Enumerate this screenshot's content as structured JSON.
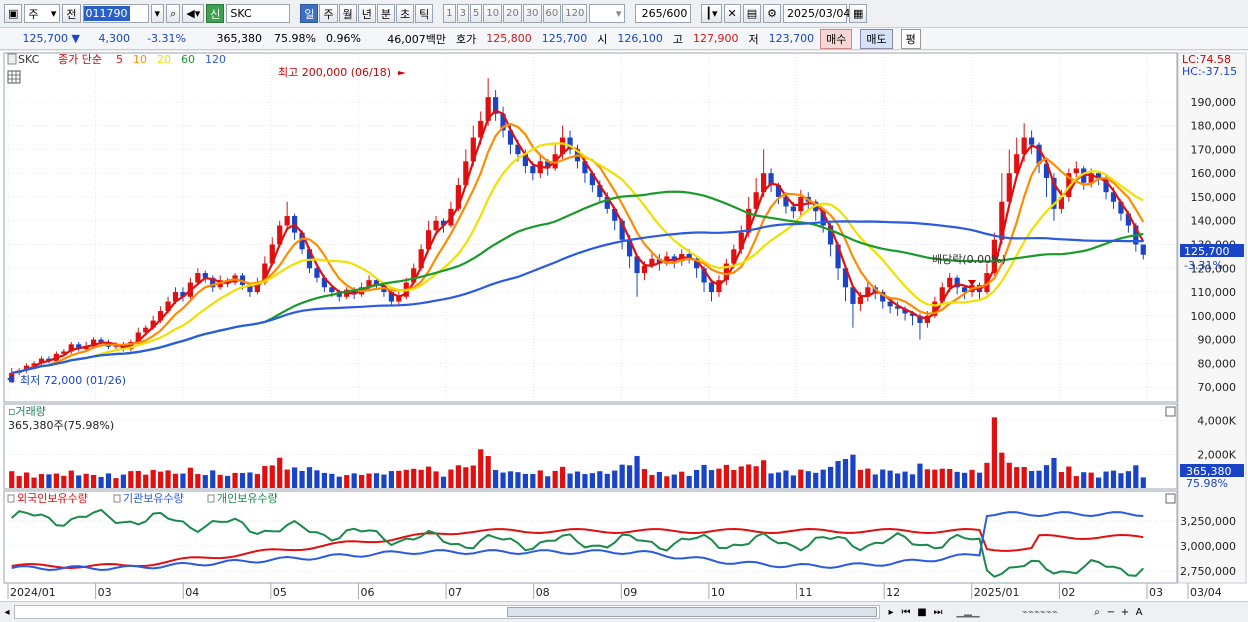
{
  "toolbar": {
    "type_select": "주",
    "prev_label": "전",
    "code": "011790",
    "badge": "신",
    "stock_name": "SKC",
    "periods": [
      "일",
      "주",
      "월",
      "년",
      "분",
      "초",
      "틱"
    ],
    "active_period": "일",
    "intervals": [
      "1",
      "3",
      "5",
      "10",
      "20",
      "30",
      "60",
      "120"
    ],
    "count": "265",
    "count_max": "/600",
    "date": "2025/03/04"
  },
  "infobar": {
    "price": "125,700",
    "change": "4,300",
    "change_pct": "-3.31%",
    "volume": "365,380",
    "vol_ratio": "75.98%",
    "turnover": "0.96%",
    "amount": "46,007백만",
    "quote_label": "호가",
    "ask": "125,800",
    "bid": "125,700",
    "open_label": "시",
    "open": "126,100",
    "high_label": "고",
    "high": "127,900",
    "low_label": "저",
    "low": "123,700",
    "buy_label": "매수",
    "sell_label": "매도",
    "avg_label": "평"
  },
  "price_panel": {
    "symbol": "SKC",
    "ma_title": "종가 단순",
    "ma_periods": [
      "5",
      "10",
      "20",
      "60",
      "120"
    ],
    "ma_colors": [
      "#e01010",
      "#ff8c00",
      "#f0e000",
      "#1a9a2a",
      "#2a5ae0"
    ],
    "lc": "LC:74.58",
    "hc": "HC:-37.15",
    "y_ticks": [
      "190,000",
      "180,000",
      "170,000",
      "160,000",
      "150,000",
      "140,000",
      "130,000",
      "120,000",
      "110,000",
      "100,000",
      "90,000",
      "80,000",
      "70,000"
    ],
    "high_annotation": "최고 200,000 (06/18)",
    "low_annotation": "최저 72,000 (01/26)",
    "dividend_annotation": "배당락(0.00%)",
    "last_price_tag": "125,700",
    "last_pct_tag": "-3.31%"
  },
  "volume_panel": {
    "title": "거래량",
    "value": "365,380주(75.98%)",
    "y_ticks": [
      "4,000K",
      "2,000K"
    ],
    "last_tag": "365,380",
    "last_pct_tag": "75.98%"
  },
  "holding_panel": {
    "series": [
      "외국인보유수량",
      "기관보유수량",
      "개인보유수량"
    ],
    "series_colors": [
      "#e01010",
      "#2a5ae0",
      "#1a8a4a"
    ],
    "y_ticks": [
      "3,250,000",
      "3,000,000",
      "2,750,000"
    ]
  },
  "x_axis": {
    "labels": [
      "2024/01",
      "03",
      "04",
      "05",
      "06",
      "07",
      "08",
      "09",
      "10",
      "11",
      "12",
      "2025/01",
      "02",
      "03",
      "03/04"
    ]
  },
  "chart_data": {
    "type": "line",
    "candles": [
      [
        76000,
        72000,
        78000,
        72000
      ],
      [
        77000,
        76000,
        78000,
        75000
      ],
      [
        79000,
        77000,
        80000,
        76000
      ],
      [
        80000,
        79000,
        81000,
        78000
      ],
      [
        82000,
        80000,
        83000,
        79000
      ],
      [
        81000,
        82000,
        83000,
        80000
      ],
      [
        84000,
        81000,
        85000,
        80000
      ],
      [
        85000,
        84000,
        86000,
        83000
      ],
      [
        88000,
        85000,
        89000,
        84000
      ],
      [
        86000,
        88000,
        89000,
        85000
      ],
      [
        87000,
        86000,
        89000,
        85000
      ],
      [
        90000,
        87000,
        91000,
        86000
      ],
      [
        89000,
        90000,
        91000,
        88000
      ],
      [
        87000,
        89000,
        90000,
        86000
      ],
      [
        88000,
        87000,
        89000,
        86000
      ],
      [
        86000,
        88000,
        89000,
        85000
      ],
      [
        89000,
        86000,
        90000,
        85000
      ],
      [
        93000,
        89000,
        95000,
        88000
      ],
      [
        95000,
        93000,
        96000,
        92000
      ],
      [
        98000,
        95000,
        100000,
        94000
      ],
      [
        102000,
        98000,
        104000,
        97000
      ],
      [
        106000,
        102000,
        108000,
        101000
      ],
      [
        110000,
        106000,
        112000,
        105000
      ],
      [
        108000,
        110000,
        112000,
        106000
      ],
      [
        114000,
        108000,
        116000,
        107000
      ],
      [
        118000,
        114000,
        120000,
        113000
      ],
      [
        116000,
        118000,
        119000,
        114000
      ],
      [
        112000,
        116000,
        117000,
        110000
      ],
      [
        115000,
        112000,
        117000,
        111000
      ],
      [
        114000,
        115000,
        116000,
        112000
      ],
      [
        117000,
        114000,
        118000,
        113000
      ],
      [
        113000,
        117000,
        118000,
        111000
      ],
      [
        110000,
        113000,
        114000,
        108000
      ],
      [
        114000,
        110000,
        116000,
        109000
      ],
      [
        122000,
        114000,
        125000,
        113000
      ],
      [
        130000,
        122000,
        133000,
        121000
      ],
      [
        138000,
        130000,
        140000,
        129000
      ],
      [
        142000,
        138000,
        148000,
        137000
      ],
      [
        135000,
        142000,
        143000,
        132000
      ],
      [
        128000,
        135000,
        136000,
        126000
      ],
      [
        120000,
        128000,
        129000,
        118000
      ],
      [
        116000,
        120000,
        121000,
        114000
      ],
      [
        112000,
        116000,
        117000,
        110000
      ],
      [
        110000,
        112000,
        113000,
        108000
      ],
      [
        108000,
        110000,
        111000,
        106000
      ],
      [
        111000,
        108000,
        112000,
        107000
      ],
      [
        109000,
        111000,
        112000,
        107000
      ],
      [
        112000,
        109000,
        114000,
        108000
      ],
      [
        115000,
        112000,
        117000,
        111000
      ],
      [
        113000,
        115000,
        116000,
        111000
      ],
      [
        110000,
        113000,
        114000,
        108000
      ],
      [
        106000,
        110000,
        111000,
        104000
      ],
      [
        108000,
        106000,
        110000,
        104000
      ],
      [
        114000,
        108000,
        116000,
        107000
      ],
      [
        120000,
        114000,
        122000,
        113000
      ],
      [
        128000,
        120000,
        130000,
        119000
      ],
      [
        136000,
        128000,
        140000,
        127000
      ],
      [
        140000,
        136000,
        142000,
        134000
      ],
      [
        138000,
        140000,
        141000,
        135000
      ],
      [
        145000,
        138000,
        148000,
        137000
      ],
      [
        155000,
        145000,
        158000,
        144000
      ],
      [
        165000,
        155000,
        170000,
        154000
      ],
      [
        175000,
        165000,
        180000,
        163000
      ],
      [
        182000,
        175000,
        186000,
        172000
      ],
      [
        192000,
        182000,
        200000,
        180000
      ],
      [
        185000,
        192000,
        195000,
        182000
      ],
      [
        178000,
        185000,
        188000,
        175000
      ],
      [
        172000,
        178000,
        180000,
        168000
      ],
      [
        168000,
        172000,
        174000,
        165000
      ],
      [
        163000,
        168000,
        170000,
        160000
      ],
      [
        160000,
        163000,
        165000,
        157000
      ],
      [
        165000,
        160000,
        168000,
        158000
      ],
      [
        162000,
        165000,
        166000,
        159000
      ],
      [
        168000,
        162000,
        172000,
        161000
      ],
      [
        175000,
        168000,
        180000,
        166000
      ],
      [
        170000,
        175000,
        178000,
        168000
      ],
      [
        165000,
        170000,
        172000,
        162000
      ],
      [
        160000,
        165000,
        166000,
        156000
      ],
      [
        155000,
        160000,
        161000,
        152000
      ],
      [
        150000,
        155000,
        157000,
        148000
      ],
      [
        145000,
        150000,
        152000,
        143000
      ],
      [
        140000,
        145000,
        146000,
        136000
      ],
      [
        132000,
        140000,
        141000,
        128000
      ],
      [
        125000,
        132000,
        134000,
        120000
      ],
      [
        118000,
        125000,
        126000,
        108000
      ],
      [
        121000,
        118000,
        123000,
        115000
      ],
      [
        124000,
        121000,
        126000,
        120000
      ],
      [
        122000,
        124000,
        126000,
        119000
      ],
      [
        125000,
        122000,
        127000,
        121000
      ],
      [
        123000,
        125000,
        126000,
        120000
      ],
      [
        126000,
        123000,
        128000,
        121000
      ],
      [
        124000,
        126000,
        128000,
        122000
      ],
      [
        120000,
        124000,
        125000,
        116000
      ],
      [
        114000,
        120000,
        121000,
        110000
      ],
      [
        110000,
        114000,
        115000,
        106000
      ],
      [
        115000,
        110000,
        117000,
        108000
      ],
      [
        122000,
        115000,
        124000,
        113000
      ],
      [
        128000,
        122000,
        130000,
        120000
      ],
      [
        135000,
        128000,
        138000,
        126000
      ],
      [
        145000,
        135000,
        150000,
        133000
      ],
      [
        152000,
        145000,
        158000,
        143000
      ],
      [
        160000,
        152000,
        170000,
        150000
      ],
      [
        155000,
        160000,
        162000,
        152000
      ],
      [
        150000,
        155000,
        156000,
        147000
      ],
      [
        146000,
        150000,
        152000,
        143000
      ],
      [
        144000,
        146000,
        148000,
        141000
      ],
      [
        150000,
        144000,
        153000,
        142000
      ],
      [
        148000,
        150000,
        152000,
        144000
      ],
      [
        144000,
        148000,
        149000,
        140000
      ],
      [
        138000,
        144000,
        145000,
        135000
      ],
      [
        130000,
        138000,
        139000,
        125000
      ],
      [
        120000,
        130000,
        131000,
        115000
      ],
      [
        112000,
        120000,
        121000,
        106000
      ],
      [
        105000,
        112000,
        113000,
        95000
      ],
      [
        108000,
        105000,
        110000,
        102000
      ],
      [
        112000,
        108000,
        114000,
        106000
      ],
      [
        110000,
        112000,
        113000,
        107000
      ],
      [
        106000,
        110000,
        111000,
        103000
      ],
      [
        104000,
        106000,
        107000,
        101000
      ],
      [
        103000,
        104000,
        106000,
        100000
      ],
      [
        101000,
        103000,
        104000,
        98000
      ],
      [
        100000,
        101000,
        102000,
        96000
      ],
      [
        97000,
        100000,
        101000,
        90000
      ],
      [
        100000,
        97000,
        102000,
        95000
      ],
      [
        106000,
        100000,
        108000,
        99000
      ],
      [
        112000,
        106000,
        114000,
        105000
      ],
      [
        116000,
        112000,
        118000,
        110000
      ],
      [
        112000,
        116000,
        117000,
        109000
      ],
      [
        110000,
        112000,
        113000,
        107000
      ],
      [
        113000,
        110000,
        115000,
        108000
      ],
      [
        110000,
        113000,
        114000,
        107000
      ],
      [
        118000,
        110000,
        122000,
        109000
      ],
      [
        132000,
        118000,
        135000,
        117000
      ],
      [
        148000,
        132000,
        160000,
        130000
      ],
      [
        160000,
        148000,
        170000,
        146000
      ],
      [
        168000,
        160000,
        175000,
        158000
      ],
      [
        175000,
        168000,
        181000,
        165000
      ],
      [
        172000,
        175000,
        178000,
        168000
      ],
      [
        164000,
        172000,
        173000,
        160000
      ],
      [
        158000,
        164000,
        166000,
        150000
      ],
      [
        145000,
        158000,
        160000,
        140000
      ],
      [
        150000,
        145000,
        153000,
        143000
      ],
      [
        160000,
        150000,
        162000,
        148000
      ],
      [
        162000,
        160000,
        165000,
        157000
      ],
      [
        156000,
        162000,
        163000,
        153000
      ],
      [
        160000,
        156000,
        162000,
        154000
      ],
      [
        158000,
        160000,
        161000,
        155000
      ],
      [
        152000,
        158000,
        159000,
        149000
      ],
      [
        148000,
        152000,
        154000,
        145000
      ],
      [
        143000,
        148000,
        149000,
        140000
      ],
      [
        138000,
        143000,
        144000,
        135000
      ],
      [
        130000,
        138000,
        139000,
        127000
      ],
      [
        125700,
        130000,
        127900,
        123700
      ]
    ],
    "note_candles": "each item [close, open, high, low] in KRW; daily candles sampled across 2024/01 – 2025/03/04",
    "y_unit": "KRW",
    "ylim": [
      65000,
      203000
    ],
    "volume_max_k": 4400,
    "holding_ylim": [
      2650000,
      3450000
    ]
  }
}
